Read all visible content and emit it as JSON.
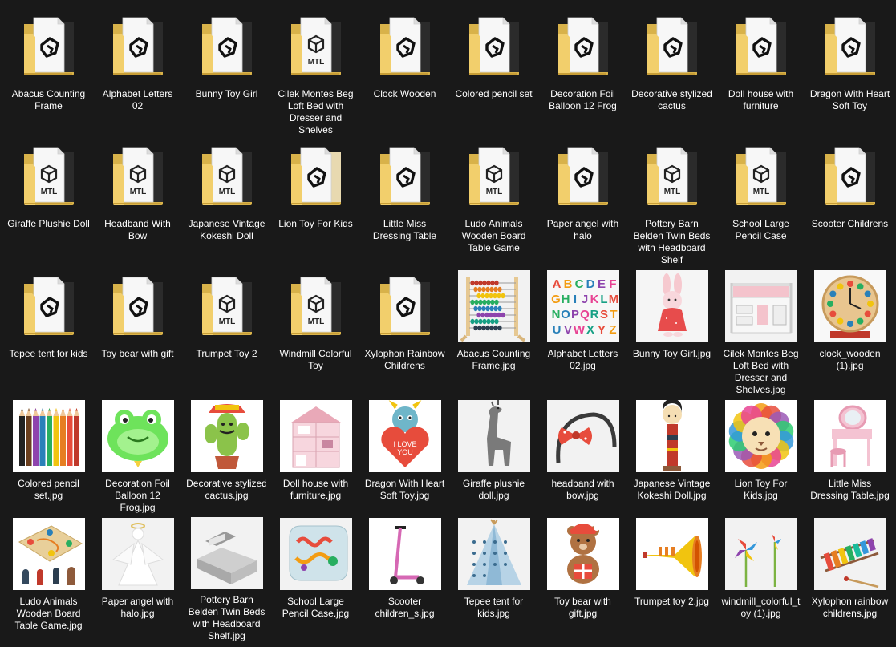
{
  "folders": [
    {
      "label": "Abacus Counting Frame",
      "badge": "box",
      "peek": "dark"
    },
    {
      "label": "Alphabet Letters 02",
      "badge": "box",
      "peek": "dark"
    },
    {
      "label": "Bunny Toy Girl",
      "badge": "box",
      "peek": "dark"
    },
    {
      "label": "Cilek Montes Beg Loft Bed with Dresser and Shelves",
      "badge": "mtl",
      "peek": "dark"
    },
    {
      "label": "Clock Wooden",
      "badge": "box",
      "peek": "dark"
    },
    {
      "label": "Colored pencil set",
      "badge": "box",
      "peek": "dark"
    },
    {
      "label": "Decoration Foil Balloon 12 Frog",
      "badge": "box",
      "peek": "dark"
    },
    {
      "label": "Decorative stylized cactus",
      "badge": "box",
      "peek": "dark"
    },
    {
      "label": "Doll house with furniture",
      "badge": "box",
      "peek": "dark"
    },
    {
      "label": "Dragon With Heart Soft Toy",
      "badge": "box",
      "peek": "dark"
    },
    {
      "label": "Giraffe Plushie Doll",
      "badge": "mtl",
      "peek": "dark"
    },
    {
      "label": "Headband With Bow",
      "badge": "mtl",
      "peek": "dark"
    },
    {
      "label": "Japanese Vintage Kokeshi Doll",
      "badge": "mtl",
      "peek": "dark"
    },
    {
      "label": "Lion Toy For Kids",
      "badge": "box",
      "peek": "light"
    },
    {
      "label": "Little Miss Dressing Table",
      "badge": "box",
      "peek": "dark"
    },
    {
      "label": "Ludo Animals Wooden Board Table Game",
      "badge": "mtl",
      "peek": "dark"
    },
    {
      "label": "Paper angel with halo",
      "badge": "box",
      "peek": "dark"
    },
    {
      "label": "Pottery Barn Belden Twin Beds with Headboard Shelf",
      "badge": "mtl",
      "peek": "dark"
    },
    {
      "label": "School Large Pencil Case",
      "badge": "mtl",
      "peek": "dark"
    },
    {
      "label": "Scooter Childrens",
      "badge": "box",
      "peek": "dark"
    },
    {
      "label": "Tepee tent for kids",
      "badge": "box",
      "peek": "dark"
    },
    {
      "label": "Toy bear with gift",
      "badge": "box",
      "peek": "dark"
    },
    {
      "label": "Trumpet Toy 2",
      "badge": "mtl",
      "peek": "dark"
    },
    {
      "label": "Windmill Colorful Toy",
      "badge": "mtl",
      "peek": "dark"
    },
    {
      "label": "Xylophon Rainbow Childrens",
      "badge": "box",
      "peek": "dark"
    }
  ],
  "images": [
    {
      "label": "Abacus Counting Frame.jpg",
      "icon": "abacus-icon",
      "bg": "#f2f2f2"
    },
    {
      "label": "Alphabet Letters 02.jpg",
      "icon": "alphabet-icon",
      "bg": "#f7f7f7"
    },
    {
      "label": "Bunny Toy Girl.jpg",
      "icon": "bunny-icon",
      "bg": "#f5f5f5"
    },
    {
      "label": "Cilek Montes Beg Loft Bed with Dresser and Shelves.jpg",
      "icon": "loft-bed-icon",
      "bg": "#f2f2f2"
    },
    {
      "label": "clock_wooden (1).jpg",
      "icon": "clock-icon",
      "bg": "#f8f8f8"
    },
    {
      "label": "Colored pencil set.jpg",
      "icon": "pencils-icon",
      "bg": "#ffffff"
    },
    {
      "label": "Decoration Foil Balloon 12 Frog.jpg",
      "icon": "frog-balloon-icon",
      "bg": "#ffffff"
    },
    {
      "label": "Decorative stylized cactus.jpg",
      "icon": "cactus-icon",
      "bg": "#ffffff"
    },
    {
      "label": "Doll house with furniture.jpg",
      "icon": "dollhouse-icon",
      "bg": "#ffffff"
    },
    {
      "label": "Dragon With Heart Soft Toy.jpg",
      "icon": "dragon-icon",
      "bg": "#ffffff"
    },
    {
      "label": "Giraffe plushie doll.jpg",
      "icon": "giraffe-icon",
      "bg": "#f2f2f2"
    },
    {
      "label": "headband with bow.jpg",
      "icon": "headband-icon",
      "bg": "#f2f2f2"
    },
    {
      "label": "Japanese Vintage Kokeshi Doll.jpg",
      "icon": "kokeshi-icon",
      "bg": "#ffffff"
    },
    {
      "label": "Lion Toy For Kids.jpg",
      "icon": "lion-icon",
      "bg": "#ffffff"
    },
    {
      "label": "Little Miss Dressing Table.jpg",
      "icon": "dressing-table-icon",
      "bg": "#ffffff"
    },
    {
      "label": "Ludo Animals Wooden Board Table Game.jpg",
      "icon": "ludo-icon",
      "bg": "#ffffff"
    },
    {
      "label": "Paper angel with halo.jpg",
      "icon": "angel-icon",
      "bg": "#f2f2f2"
    },
    {
      "label": "Pottery Barn Belden Twin Beds with Headboard Shelf.jpg",
      "icon": "twin-bed-icon",
      "bg": "#f2f2f2"
    },
    {
      "label": "School Large Pencil Case.jpg",
      "icon": "pencil-case-icon",
      "bg": "#f2f2f2"
    },
    {
      "label": "Scooter children_s.jpg",
      "icon": "scooter-icon",
      "bg": "#ffffff"
    },
    {
      "label": "Tepee tent for kids.jpg",
      "icon": "tepee-icon",
      "bg": "#f2f2f2"
    },
    {
      "label": "Toy bear with gift.jpg",
      "icon": "teddy-bear-icon",
      "bg": "#ffffff"
    },
    {
      "label": "Trumpet toy 2.jpg",
      "icon": "trumpet-icon",
      "bg": "#ffffff"
    },
    {
      "label": "windmill_colorful_toy (1).jpg",
      "icon": "windmill-icon",
      "bg": "#f2f2f2"
    },
    {
      "label": "Xylophon rainbow childrens.jpg",
      "icon": "xylophone-icon",
      "bg": "#f2f2f2"
    }
  ]
}
